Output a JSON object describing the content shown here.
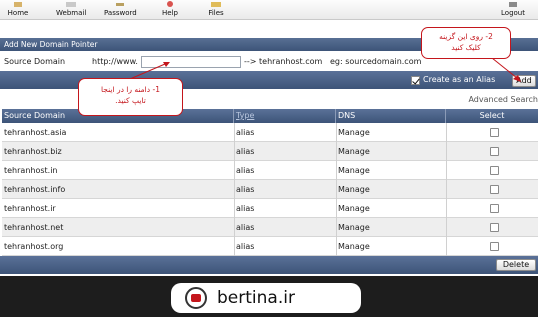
{
  "toolbar": {
    "items": [
      {
        "label": "Home",
        "icon": "home-icon"
      },
      {
        "label": "Webmail",
        "icon": "mail-icon"
      },
      {
        "label": "Password",
        "icon": "key-icon"
      },
      {
        "label": "Help",
        "icon": "help-icon"
      },
      {
        "label": "Files",
        "icon": "folder-icon"
      },
      {
        "label": "Logout",
        "icon": "logout-icon"
      }
    ]
  },
  "section_title": "Add New Domain Pointer",
  "form": {
    "source_label": "Source Domain",
    "prefix": "http://www.",
    "input_value": "",
    "arrow_text": "--> tehranhost.com",
    "example_text": "eg: sourcedomain.com",
    "alias_label": "Create as an Alias",
    "alias_checked": true,
    "add_label": "Add"
  },
  "advanced_search": "Advanced Search",
  "table": {
    "headers": {
      "source": "Source Domain",
      "type": "Type",
      "dns": "DNS",
      "select": "Select"
    },
    "rows": [
      {
        "source": "tehranhost.asia",
        "type": "alias",
        "dns": "Manage"
      },
      {
        "source": "tehranhost.biz",
        "type": "alias",
        "dns": "Manage"
      },
      {
        "source": "tehranhost.in",
        "type": "alias",
        "dns": "Manage"
      },
      {
        "source": "tehranhost.info",
        "type": "alias",
        "dns": "Manage"
      },
      {
        "source": "tehranhost.ir",
        "type": "alias",
        "dns": "Manage"
      },
      {
        "source": "tehranhost.net",
        "type": "alias",
        "dns": "Manage"
      },
      {
        "source": "tehranhost.org",
        "type": "alias",
        "dns": "Manage"
      }
    ]
  },
  "delete_label": "Delete",
  "annotations": {
    "callout_1_line_1": "1- دامنه را در اینجا",
    "callout_1_line_2": "تایپ کنید.",
    "callout_2_line_1": "2- روی این گزینه",
    "callout_2_line_2": "کلیک کنید"
  },
  "watermark": {
    "text": "bertina.ir"
  },
  "colors": {
    "header_blue": "#3d5478",
    "callout_red": "#c4161c"
  }
}
